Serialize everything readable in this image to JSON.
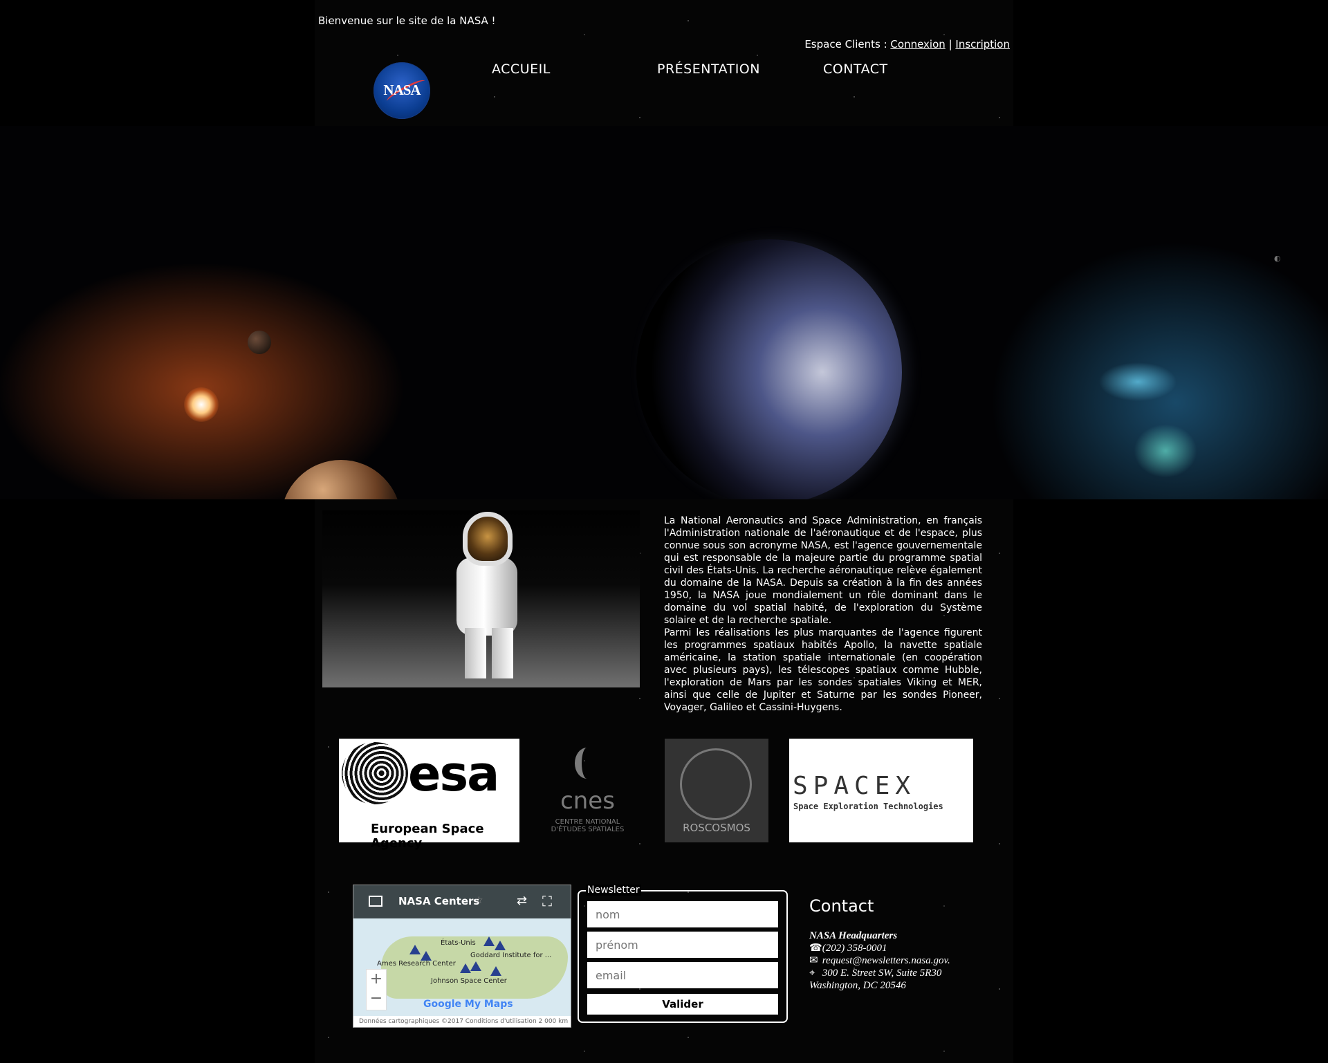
{
  "header": {
    "welcome": "Bienvenue sur le site de la NASA !",
    "espace_label": "Espace Clients :",
    "login": "Connexion",
    "separator": "|",
    "signup": "Inscription",
    "logo_text": "NASA",
    "nav": [
      {
        "label": "ACCUEIL"
      },
      {
        "label": "PRÉSENTATION"
      },
      {
        "label": "CONTACT"
      }
    ]
  },
  "main": {
    "about_paragraphs": [
      "La National Aeronautics and Space Administration, en français l'Administration nationale de l'aéronautique et de l'espace, plus connue sous son acronyme NASA, est l'agence gouvernementale qui est responsable de la majeure partie du programme spatial civil des États-Unis. La recherche aéronautique relève également du domaine de la NASA. Depuis sa création à la fin des années 1950, la NASA joue mondialement un rôle dominant dans le domaine du vol spatial habité, de l'exploration du Système solaire et de la recherche spatiale.",
      "Parmi les réalisations les plus marquantes de l'agence figurent les programmes spatiaux habités Apollo, la navette spatiale américaine, la station spatiale internationale (en coopération avec plusieurs pays), les télescopes spatiaux comme Hubble, l'exploration de Mars par les sondes spatiales Viking et MER, ainsi que celle de Jupiter et Saturne par les sondes Pioneer, Voyager, Galileo et Cassini-Huygens."
    ],
    "partners": {
      "esa_word": "esa",
      "esa_subtitle": "European Space Agency",
      "cnes_word": "cnes",
      "cnes_subtitle": "CENTRE NATIONAL D'ÉTUDES SPATIALES",
      "roscosmos": "ROSCOSMOS",
      "spacex_word": "SPACEX",
      "spacex_subtitle": "Space Exploration Technologies"
    }
  },
  "footer": {
    "map": {
      "title": "NASA Centers",
      "labels": {
        "etats_unis": "États-Unis",
        "goddard": "Goddard Institute for ...",
        "ames": "Ames Research Center",
        "johnson": "Johnson Space Center"
      },
      "zoom_in": "+",
      "zoom_out": "−",
      "google": "Google My Maps",
      "footer": "Données cartographiques ©2017   Conditions d'utilisation   2 000 km"
    },
    "newsletter": {
      "title": "Newsletter",
      "nom_placeholder": "nom",
      "prenom_placeholder": "prénom",
      "email_placeholder": "email",
      "submit": "Valider"
    },
    "contact": {
      "title": "Contact",
      "organization": "NASA Headquarters",
      "phone": "(202) 358-0001",
      "email": "request@newsletters.nasa.gov.",
      "address_line1": "300 E. Street SW, Suite 5R30",
      "address_line2": "Washington, DC 20546"
    }
  },
  "icons": {
    "phone": "phone-icon",
    "mail": "mail-icon",
    "location": "location-pin-icon"
  }
}
